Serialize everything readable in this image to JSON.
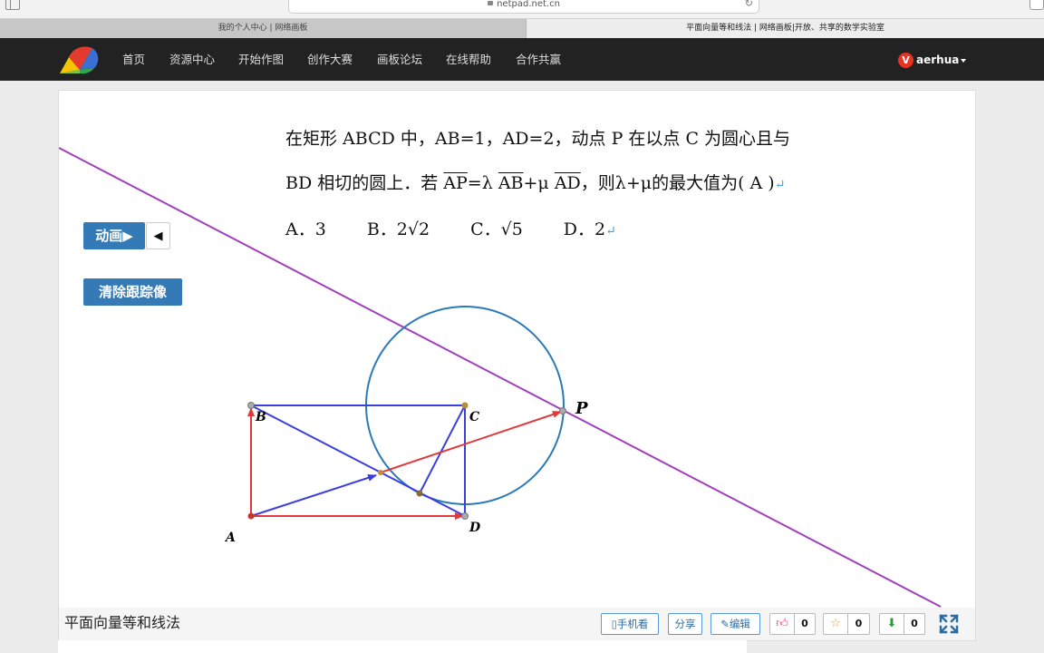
{
  "browser": {
    "url": "netpad.net.cn",
    "tabs": [
      {
        "label": "我的个人中心 | 网络画板",
        "active": false
      },
      {
        "label": "平面向量等和线法 | 网络画板|开放、共享的数学实验室",
        "active": true
      }
    ]
  },
  "nav": {
    "items": [
      "首页",
      "资源中心",
      "开始作图",
      "创作大赛",
      "画板论坛",
      "在线帮助",
      "合作共赢"
    ],
    "user": "aerhua",
    "user_badge": "V"
  },
  "question": {
    "line1": "在矩形 ABCD 中，AB=1，AD=2，动点 P 在以点 C 为圆心且与",
    "line2_pre": "BD 相切的圆上．若 ",
    "vec_ap": "AP",
    "eq_lambda": "=λ ",
    "vec_ab": "AB",
    "plus_mu": "+μ ",
    "vec_ad": "AD",
    "line2_post": "，则λ+μ的最大值为( A )",
    "options": [
      {
        "label": "A．3"
      },
      {
        "label": "B．2√2"
      },
      {
        "label": "C．√5"
      },
      {
        "label": "D．2"
      }
    ]
  },
  "controls": {
    "animate": "动画▶",
    "back": "◀",
    "clear_trace": "清除跟踪像"
  },
  "figure": {
    "labels": {
      "A": "A",
      "B": "B",
      "C": "C",
      "D": "D",
      "P": "P"
    },
    "colors": {
      "rect": "#3b3fdc",
      "vector": "#e23a3a",
      "circle": "#2a7ab8",
      "line": "#a23fbf"
    }
  },
  "footer": {
    "title": "平面向量等和线法",
    "mobile": "手机看",
    "share": "分享",
    "edit": "编辑",
    "like_count": "0",
    "star_count": "0",
    "download_count": "0"
  },
  "colors": {
    "nav_bg": "#222222",
    "button_blue": "#337ab7"
  }
}
